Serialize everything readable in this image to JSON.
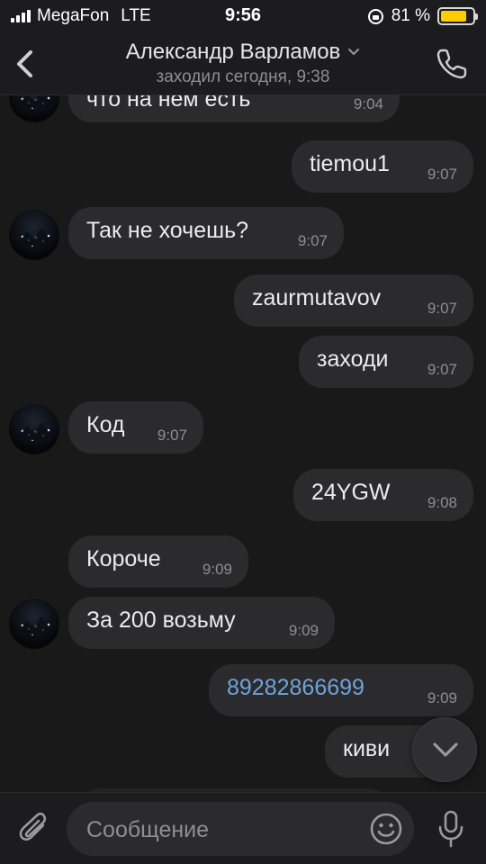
{
  "status": {
    "carrier": "MegaFon",
    "network": "LTE",
    "time": "9:56",
    "battery_text": "81 %",
    "battery_level": 0.81,
    "battery_color": "#ffcc00"
  },
  "header": {
    "contact_name": "Александр Варламов",
    "last_seen": "заходил сегодня, 9:38"
  },
  "messages": [
    {
      "dir": "in",
      "text": "что на нем есть",
      "time": "9:04",
      "avatar": true
    },
    {
      "dir": "out",
      "text": "tiemou1",
      "time": "9:07"
    },
    {
      "dir": "in",
      "text": "Так не хочешь?",
      "time": "9:07",
      "avatar": true
    },
    {
      "dir": "out",
      "text": "zaurmutavov",
      "time": "9:07"
    },
    {
      "dir": "out",
      "text": "заходи",
      "time": "9:07"
    },
    {
      "dir": "in",
      "text": "Код",
      "time": "9:07",
      "avatar": true
    },
    {
      "dir": "out",
      "text": "24YGW",
      "time": "9:08"
    },
    {
      "dir": "in",
      "text": "Короче",
      "time": "9:09",
      "avatar": false
    },
    {
      "dir": "in",
      "text": "За 200 возьму",
      "time": "9:09",
      "avatar": true
    },
    {
      "dir": "out",
      "text": "89282866699",
      "time": "9:09",
      "link": true
    },
    {
      "dir": "out",
      "text": "киви",
      "time": ""
    }
  ],
  "composer": {
    "placeholder": "Сообщение"
  },
  "colors": {
    "background": "#19191a",
    "bubble": "#2b2b2d",
    "link": "#6fa3dd"
  },
  "icons": [
    "back-chevron-icon",
    "phone-icon",
    "chevron-down-icon",
    "lock-rotation-icon",
    "paperclip-icon",
    "emoji-icon",
    "microphone-icon",
    "scroll-down-icon"
  ]
}
